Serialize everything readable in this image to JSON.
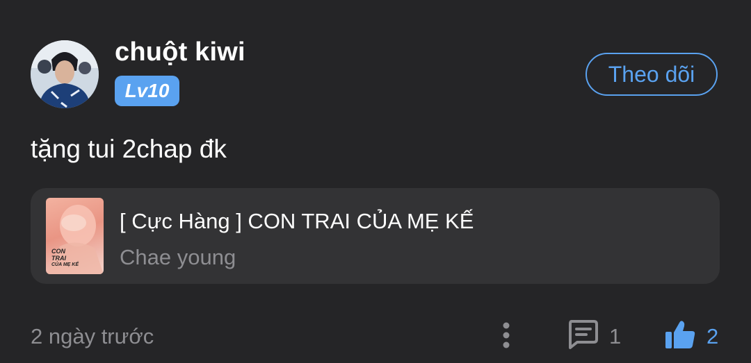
{
  "user": {
    "name": "chuột kiwi",
    "level": "Lv10",
    "follow_label": "Theo dõi"
  },
  "comment": {
    "text": "tặng tui 2chap đk"
  },
  "story": {
    "title": "[ Cực Hàng ] CON TRAI CỦA MẸ KẾ",
    "author": "Chae young",
    "cover_text_line1": "CON",
    "cover_text_line2": "TRAI",
    "cover_text_line3": "CỦA MẸ KẾ"
  },
  "footer": {
    "time": "2 ngày trước",
    "comment_count": "1",
    "like_count": "2"
  },
  "colors": {
    "background": "#252527",
    "card": "#333335",
    "accent": "#5aa2f0",
    "muted": "#8e8e92"
  },
  "icons": {
    "more": "more-vertical-icon",
    "comment": "comment-icon",
    "like": "thumbs-up-icon"
  }
}
